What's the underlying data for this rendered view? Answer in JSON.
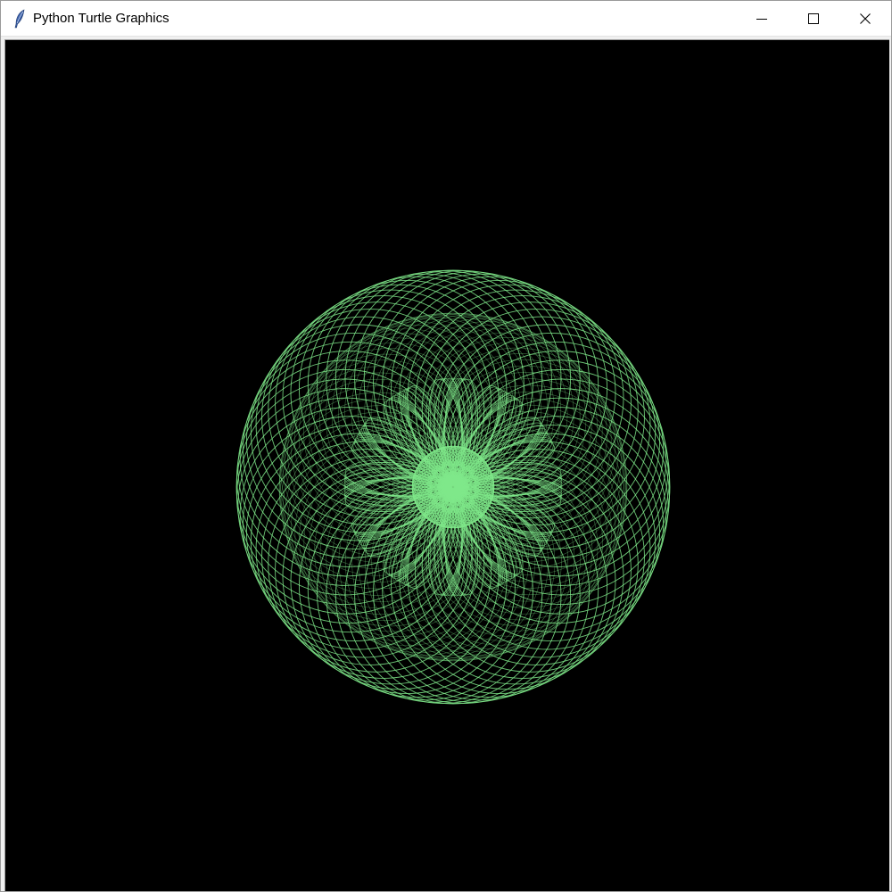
{
  "window": {
    "title": "Python Turtle Graphics",
    "icon": "feather-icon",
    "controls": {
      "minimize_icon": "minimize-icon",
      "maximize_icon": "maximize-icon",
      "close_icon": "close-icon"
    }
  },
  "canvas": {
    "background_color": "#000000",
    "pen_color": "#7fe88a",
    "pattern": "spirograph"
  }
}
